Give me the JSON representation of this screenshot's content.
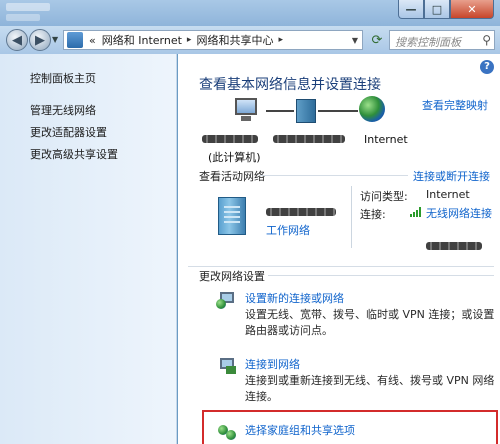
{
  "window": {
    "minimize_glyph": "—",
    "maximize_glyph": "□",
    "close_glyph": "✕"
  },
  "address": {
    "back_glyph": "◀",
    "forward_glyph": "▶",
    "prefix": "«",
    "crumbs": [
      "网络和 Internet",
      "网络和共享中心"
    ],
    "separator": "▸",
    "search_placeholder": "搜索控制面板"
  },
  "sidebar": {
    "items": [
      {
        "label": "控制面板主页"
      },
      {
        "label": "管理无线网络"
      },
      {
        "label": "更改适配器设置"
      },
      {
        "label": "更改高级共享设置"
      }
    ]
  },
  "main": {
    "heading": "查看基本网络信息并设置连接",
    "view_full_map": "查看完整映射",
    "map": {
      "computer_label": "(此计算机)",
      "internet_label": "Internet"
    },
    "active_networks_label": "查看活动网络",
    "connect_disconnect": "连接或断开连接",
    "active": {
      "network_type": "工作网络",
      "access_type_label": "访问类型:",
      "access_type_value": "Internet",
      "connection_label": "连接:",
      "connection_value": "无线网络连接"
    },
    "change_settings_label": "更改网络设置",
    "tasks": [
      {
        "title": "设置新的连接或网络",
        "desc": "设置无线、宽带、拨号、临时或 VPN 连接；或设置路由器或访问点。"
      },
      {
        "title": "连接到网络",
        "desc": "连接到或重新连接到无线、有线、拨号或 VPN 网络连接。"
      },
      {
        "title": "选择家庭组和共享选项",
        "desc": ""
      }
    ]
  },
  "colors": {
    "link": "#1064cc",
    "heading": "#1b3f7a",
    "highlight": "#d32b2b"
  }
}
